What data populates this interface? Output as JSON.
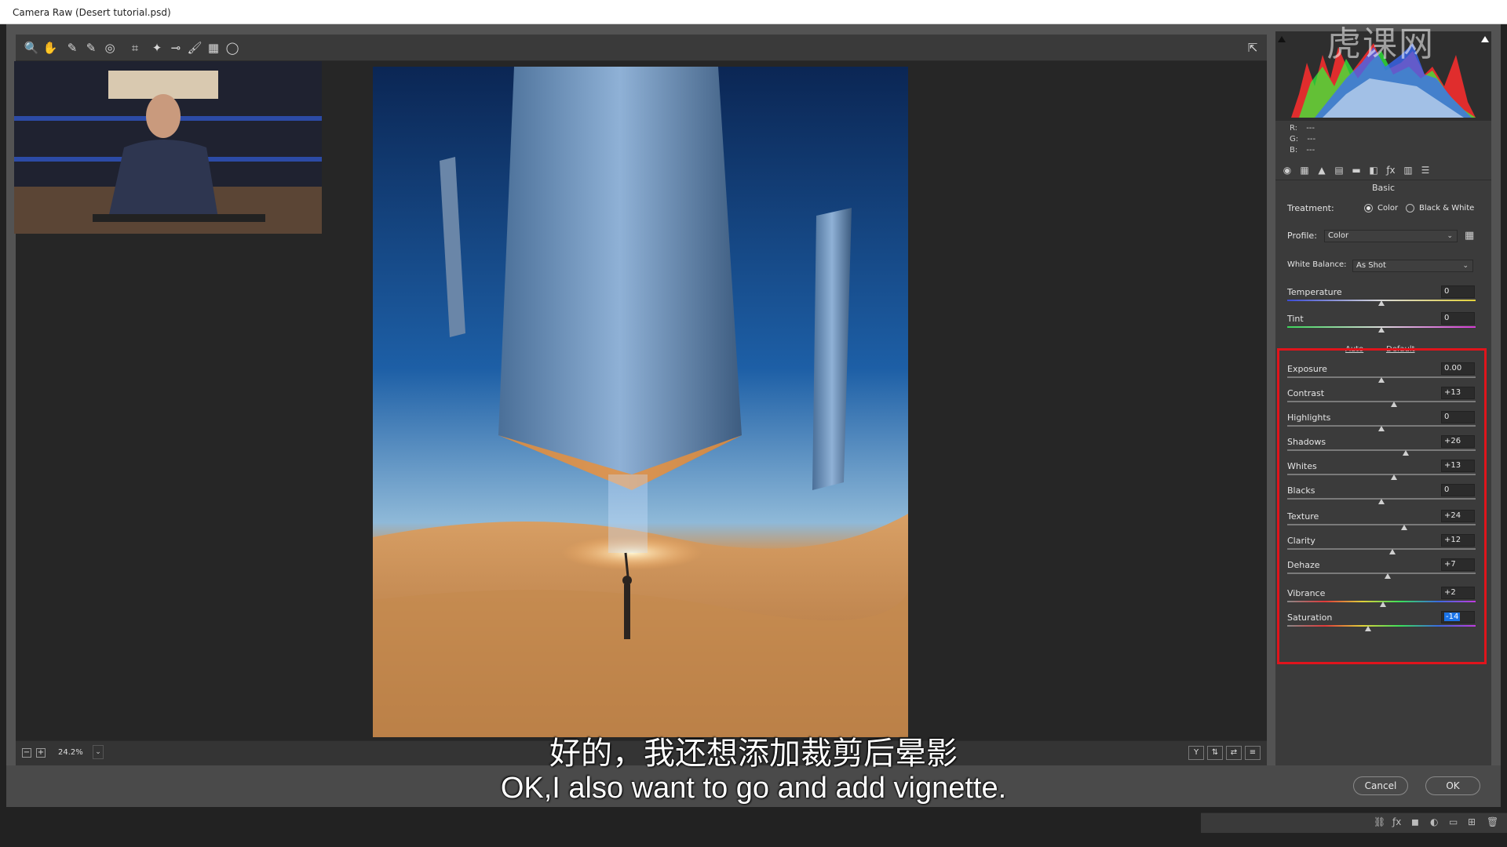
{
  "window": {
    "title": "Camera Raw (Desert tutorial.psd)"
  },
  "toolbar": {
    "tools": [
      {
        "name": "zoom-tool-icon",
        "glyph": "🔍"
      },
      {
        "name": "hand-tool-icon",
        "glyph": "✋"
      },
      {
        "name": "white-balance-tool-icon",
        "glyph": "✎"
      },
      {
        "name": "color-sampler-tool-icon",
        "glyph": "✎"
      },
      {
        "name": "targeted-adjustment-tool-icon",
        "glyph": "◎"
      },
      {
        "name": "crop-tool-icon",
        "glyph": "⌗"
      },
      {
        "name": "spot-removal-tool-icon",
        "glyph": "✦"
      },
      {
        "name": "red-eye-tool-icon",
        "glyph": "⊸"
      },
      {
        "name": "adjustment-brush-icon",
        "glyph": "🖌"
      },
      {
        "name": "graduated-filter-icon",
        "glyph": "▦"
      },
      {
        "name": "radial-filter-icon",
        "glyph": "◯"
      }
    ],
    "fullscreen_icon": "⇱"
  },
  "bottombar": {
    "zoom_value": "24.2%",
    "zoom_out_label": "−",
    "zoom_in_label": "+",
    "view_toggles": [
      "Y",
      "⇅",
      "⇄",
      "≡"
    ]
  },
  "histogram": {
    "r_label": "R:",
    "g_label": "G:",
    "b_label": "B:",
    "r_value": "---",
    "g_value": "---",
    "b_value": "---"
  },
  "panel": {
    "title": "Basic",
    "treatment_label": "Treatment:",
    "treatment_options": [
      "Color",
      "Black & White"
    ],
    "treatment_selected": "Color",
    "profile_label": "Profile:",
    "profile_value": "Color",
    "white_balance_label": "White Balance:",
    "white_balance_value": "As Shot",
    "auto_label": "Auto",
    "default_label": "Default",
    "sliders_top": [
      {
        "label": "Temperature",
        "value": "0",
        "pos": 0.5
      },
      {
        "label": "Tint",
        "value": "0",
        "pos": 0.5
      }
    ],
    "sliders_tone": [
      {
        "label": "Exposure",
        "value": "0.00",
        "pos": 0.5
      },
      {
        "label": "Contrast",
        "value": "+13",
        "pos": 0.565
      },
      {
        "label": "Highlights",
        "value": "0",
        "pos": 0.5
      },
      {
        "label": "Shadows",
        "value": "+26",
        "pos": 0.63
      },
      {
        "label": "Whites",
        "value": "+13",
        "pos": 0.565
      },
      {
        "label": "Blacks",
        "value": "0",
        "pos": 0.5
      }
    ],
    "sliders_presence": [
      {
        "label": "Texture",
        "value": "+24",
        "pos": 0.62
      },
      {
        "label": "Clarity",
        "value": "+12",
        "pos": 0.56
      },
      {
        "label": "Dehaze",
        "value": "+7",
        "pos": 0.535
      }
    ],
    "sliders_color": [
      {
        "label": "Vibrance",
        "value": "+2",
        "pos": 0.51
      },
      {
        "label": "Saturation",
        "value": "-14",
        "pos": 0.43
      }
    ]
  },
  "footer": {
    "cancel_label": "Cancel",
    "ok_label": "OK"
  },
  "subtitles": {
    "chinese": "好的，我还想添加裁剪后晕影",
    "english": "OK,I also want to go and add vignette."
  },
  "watermark": "虎课网",
  "colors": {
    "highlight_box": "#e0141c",
    "panel_bg": "#3b3b3b",
    "selected_value": "#1a73e8"
  }
}
